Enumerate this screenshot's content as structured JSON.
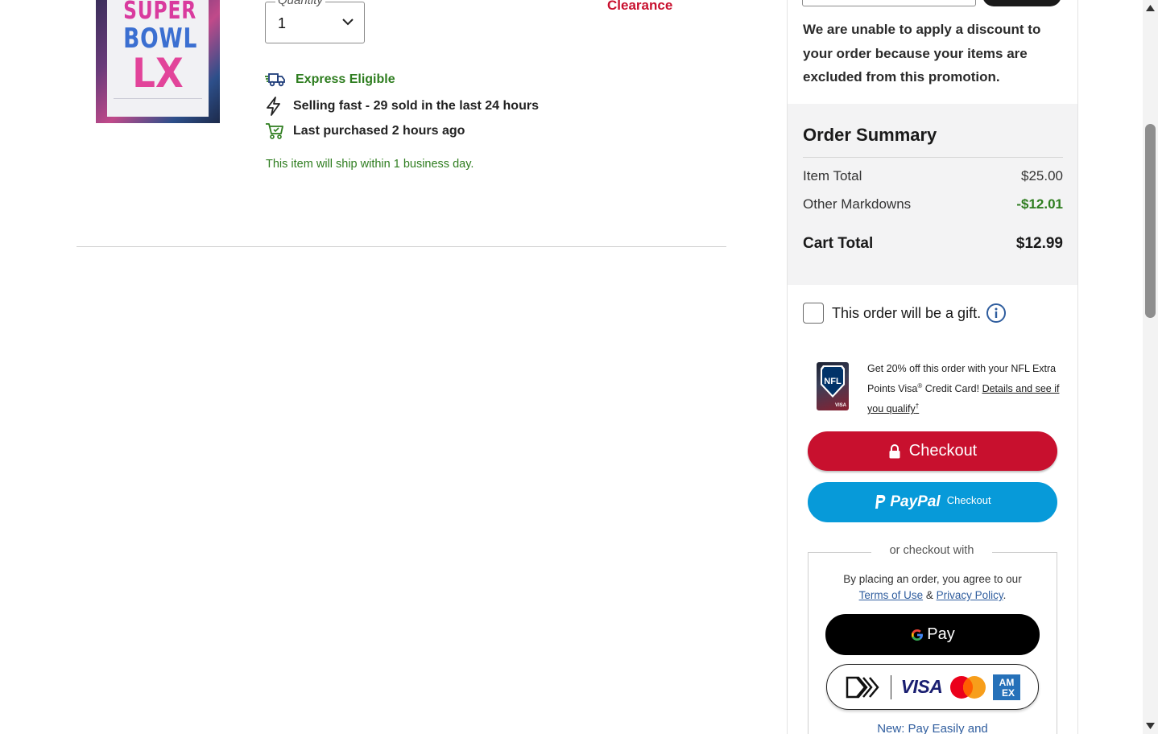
{
  "product": {
    "image_text": [
      "SUPER",
      "BOWL",
      "LX"
    ],
    "quantity_label": "Quantity",
    "quantity_value": "1",
    "clearance_label": "Clearance",
    "features": [
      {
        "icon": "truck-icon",
        "text": "Express Eligible"
      },
      {
        "icon": "lightning-bolt-icon",
        "text": "Selling fast - 29 sold in the last 24 hours"
      },
      {
        "icon": "shopping-cart-icon",
        "text": "Last purchased 2 hours ago"
      }
    ],
    "ship_note": "This item will ship within 1 business day."
  },
  "promo": {
    "message": "We are unable to apply a discount to your order because your items are excluded from this promotion."
  },
  "order_summary": {
    "title": "Order Summary",
    "rows": [
      {
        "label": "Item Total",
        "value": "$25.00"
      },
      {
        "label": "Other Markdowns",
        "value": "-$12.01"
      }
    ],
    "total_label": "Cart Total",
    "total_value": "$12.99"
  },
  "gift": {
    "label": "This order will be a gift.",
    "checked": false
  },
  "credit_card_offer": {
    "text_before": "Get 20% off this order with your NFL Extra Points Visa",
    "registered": "®",
    "text_after": " Credit Card! ",
    "link_text": "Details and see if you qualify",
    "link_sup": "†",
    "card_text": "NFL",
    "card_brand": "VISA"
  },
  "checkout": {
    "checkout_label": "Checkout",
    "paypal_word": "PayPal",
    "paypal_sub": "Checkout",
    "alt_legend": "or checkout with",
    "agree_before": "By placing an order, you agree to our ",
    "terms_link": "Terms of Use",
    "agree_and": " & ",
    "privacy_link": "Privacy Policy",
    "agree_end": ".",
    "gpay_label": "Pay",
    "visa_label": "VISA",
    "amex_label": "AM EX",
    "new_pay_text": "New: Pay Easily and"
  },
  "colors": {
    "brand_red": "#c8102e",
    "paypal_blue": "#079ad9",
    "success_green": "#2e7d1f",
    "link_blue": "#2f5d9e"
  }
}
